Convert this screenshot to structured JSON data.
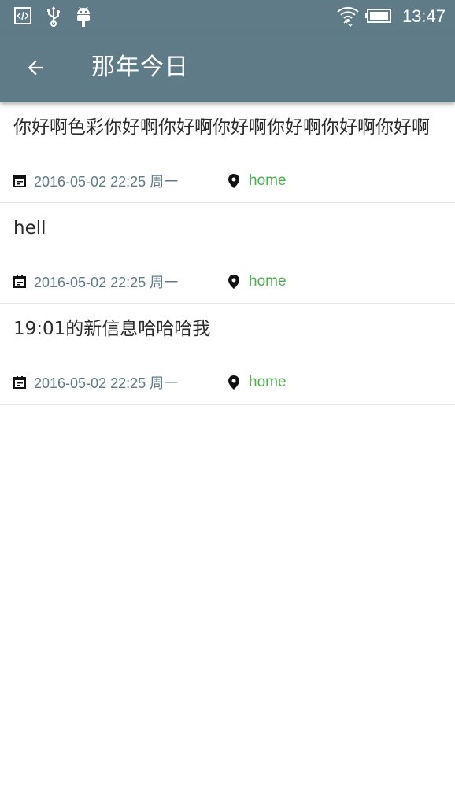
{
  "status_bar": {
    "time": "13:47",
    "icons": [
      "code-icon",
      "usb-icon",
      "android-icon",
      "wifi-icon",
      "battery-icon"
    ]
  },
  "app_bar": {
    "title": "那年今日",
    "back_icon": "arrow-back-icon"
  },
  "colors": {
    "primary": "#5f7b88",
    "date_text": "#5f7b88",
    "location_text": "#4caf50",
    "title_text": "#2b2b2b"
  },
  "entries": [
    {
      "title": "你好啊色彩你好啊你好啊你好啊你好啊你好啊你好啊",
      "date": "2016-05-02 22:25 周一",
      "location": "home"
    },
    {
      "title": "hell",
      "date": "2016-05-02 22:25 周一",
      "location": "home"
    },
    {
      "title": "19:01的新信息哈哈哈我",
      "date": "2016-05-02 22:25 周一",
      "location": "home"
    }
  ]
}
